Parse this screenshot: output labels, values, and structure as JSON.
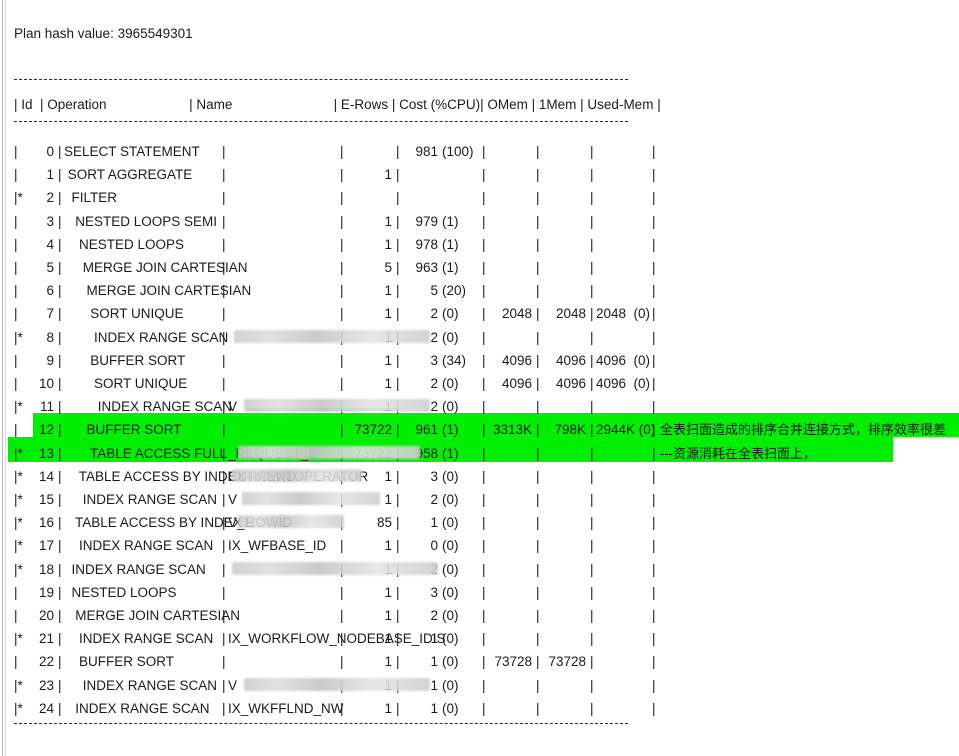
{
  "document": {
    "plan_hash_label": "Plan hash value: 3965549301",
    "separator": "----------------------------------------------------------------------------------------"
  },
  "table": {
    "header": "| Id  | Operation                      | Name                           | E-Rows | Cost (%CPU)| OMem | 1Mem | Used-Mem |",
    "columns": [
      "Id",
      "Operation",
      "Name",
      "E-Rows",
      "Cost (%CPU)",
      "OMem",
      "1Mem",
      "Used-Mem"
    ],
    "rows": [
      {
        "star": "",
        "id": "0",
        "operation": "SELECT STATEMENT",
        "name": "",
        "name_redacted": false,
        "erows": "",
        "cost": "981",
        "cpu": "(100)",
        "omem": "",
        "mem1": "",
        "used": "",
        "highlight": false,
        "note": ""
      },
      {
        "star": "",
        "id": "1",
        "operation": " SORT AGGREGATE",
        "name": "",
        "name_redacted": false,
        "erows": "1",
        "cost": "",
        "cpu": "",
        "omem": "",
        "mem1": "",
        "used": "",
        "highlight": false,
        "note": ""
      },
      {
        "star": "*",
        "id": "2",
        "operation": "  FILTER",
        "name": "",
        "name_redacted": false,
        "erows": "",
        "cost": "",
        "cpu": "",
        "omem": "",
        "mem1": "",
        "used": "",
        "highlight": false,
        "note": ""
      },
      {
        "star": "",
        "id": "3",
        "operation": "   NESTED LOOPS SEMI",
        "name": "",
        "name_redacted": false,
        "erows": "1",
        "cost": "979",
        "cpu": "(1)",
        "omem": "",
        "mem1": "",
        "used": "",
        "highlight": false,
        "note": ""
      },
      {
        "star": "",
        "id": "4",
        "operation": "    NESTED LOOPS",
        "name": "",
        "name_redacted": false,
        "erows": "1",
        "cost": "978",
        "cpu": "(1)",
        "omem": "",
        "mem1": "",
        "used": "",
        "highlight": false,
        "note": ""
      },
      {
        "star": "",
        "id": "5",
        "operation": "     MERGE JOIN CARTESIAN",
        "name": "",
        "name_redacted": false,
        "erows": "5",
        "cost": "963",
        "cpu": "(1)",
        "omem": "",
        "mem1": "",
        "used": "",
        "highlight": false,
        "note": ""
      },
      {
        "star": "",
        "id": "6",
        "operation": "      MERGE JOIN CARTESIAN",
        "name": "",
        "name_redacted": false,
        "erows": "1",
        "cost": "5",
        "cpu": "(20)",
        "omem": "",
        "mem1": "",
        "used": "",
        "highlight": false,
        "note": ""
      },
      {
        "star": "",
        "id": "7",
        "operation": "       SORT UNIQUE",
        "name": "",
        "name_redacted": false,
        "erows": "1",
        "cost": "2",
        "cpu": "(0)",
        "omem": "2048",
        "mem1": "2048",
        "used": "2048  (0)",
        "highlight": false,
        "note": ""
      },
      {
        "star": "*",
        "id": "8",
        "operation": "        INDEX RANGE SCAN",
        "name": "",
        "name_redacted": true,
        "erows": "1",
        "cost": "2",
        "cpu": "(0)",
        "omem": "",
        "mem1": "",
        "used": "",
        "highlight": false,
        "note": ""
      },
      {
        "star": "",
        "id": "9",
        "operation": "       BUFFER SORT",
        "name": "",
        "name_redacted": false,
        "erows": "1",
        "cost": "3",
        "cpu": "(34)",
        "omem": "4096",
        "mem1": "4096",
        "used": "4096  (0)",
        "highlight": false,
        "note": ""
      },
      {
        "star": "",
        "id": "10",
        "operation": "        SORT UNIQUE",
        "name": "",
        "name_redacted": false,
        "erows": "1",
        "cost": "2",
        "cpu": "(0)",
        "omem": "4096",
        "mem1": "4096",
        "used": "4096  (0)",
        "highlight": false,
        "note": ""
      },
      {
        "star": "*",
        "id": "11",
        "operation": "         INDEX RANGE SCAN",
        "name": "V",
        "name_redacted": true,
        "erows": "1",
        "cost": "2",
        "cpu": "(0)",
        "omem": "",
        "mem1": "",
        "used": "",
        "highlight": false,
        "note": ""
      },
      {
        "star": "",
        "id": "12",
        "operation": "      BUFFER SORT",
        "name": "",
        "name_redacted": false,
        "erows": "73722",
        "cost": "961",
        "cpu": "(1)",
        "omem": "3313K",
        "mem1": "798K",
        "used": "2944K (0)",
        "highlight": true,
        "note": "全表扫面造成的排序合并连接方式，排序效率很差"
      },
      {
        "star": "*",
        "id": "13",
        "operation": "       TABLE ACCESS FULL",
        "name": "_REQUEST_E",
        "name_redacted": true,
        "erows": "73722",
        "cost": "958",
        "cpu": "(1)",
        "omem": "",
        "mem1": "",
        "used": "",
        "highlight": true,
        "note": "---资源消耗在全表扫面上，"
      },
      {
        "star": "*",
        "id": "14",
        "operation": "    TABLE ACCESS BY INDEX ROWID",
        "name": "CURRENTOPERATOR",
        "name_redacted": true,
        "erows": "1",
        "cost": "3",
        "cpu": "(0)",
        "omem": "",
        "mem1": "",
        "used": "",
        "highlight": false,
        "note": ""
      },
      {
        "star": "*",
        "id": "15",
        "operation": "     INDEX RANGE SCAN",
        "name": "V",
        "name_redacted": true,
        "erows": "1",
        "cost": "2",
        "cpu": "(0)",
        "omem": "",
        "mem1": "",
        "used": "",
        "highlight": false,
        "note": ""
      },
      {
        "star": "*",
        "id": "16",
        "operation": "   TABLE ACCESS BY INDEX ROWID",
        "name": "V_E",
        "name_redacted": true,
        "erows": "85",
        "cost": "1",
        "cpu": "(0)",
        "omem": "",
        "mem1": "",
        "used": "",
        "highlight": false,
        "note": ""
      },
      {
        "star": "*",
        "id": "17",
        "operation": "    INDEX RANGE SCAN",
        "name": "IX_WFBASE_ID",
        "name_redacted": false,
        "erows": "1",
        "cost": "0",
        "cpu": "(0)",
        "omem": "",
        "mem1": "",
        "used": "",
        "highlight": false,
        "note": ""
      },
      {
        "star": "*",
        "id": "18",
        "operation": "  INDEX RANGE SCAN",
        "name": "",
        "name_redacted": true,
        "erows": "1",
        "cost": "2",
        "cpu": "(0)",
        "omem": "",
        "mem1": "",
        "used": "",
        "highlight": false,
        "note": ""
      },
      {
        "star": "",
        "id": "19",
        "operation": "  NESTED LOOPS",
        "name": "",
        "name_redacted": false,
        "erows": "1",
        "cost": "3",
        "cpu": "(0)",
        "omem": "",
        "mem1": "",
        "used": "",
        "highlight": false,
        "note": ""
      },
      {
        "star": "",
        "id": "20",
        "operation": "   MERGE JOIN CARTESIAN",
        "name": "",
        "name_redacted": false,
        "erows": "1",
        "cost": "2",
        "cpu": "(0)",
        "omem": "",
        "mem1": "",
        "used": "",
        "highlight": false,
        "note": ""
      },
      {
        "star": "*",
        "id": "21",
        "operation": "    INDEX RANGE SCAN",
        "name": "IX_WORKFLOW_NODEBASE_IDIS",
        "name_redacted": false,
        "erows": "1",
        "cost": "1",
        "cpu": "(0)",
        "omem": "",
        "mem1": "",
        "used": "",
        "highlight": false,
        "note": ""
      },
      {
        "star": "",
        "id": "22",
        "operation": "    BUFFER SORT",
        "name": "",
        "name_redacted": false,
        "erows": "1",
        "cost": "1",
        "cpu": "(0)",
        "omem": "73728",
        "mem1": "73728",
        "used": "",
        "highlight": false,
        "note": ""
      },
      {
        "star": "*",
        "id": "23",
        "operation": "     INDEX RANGE SCAN",
        "name": "V",
        "name_redacted": true,
        "erows": "1",
        "cost": "1",
        "cpu": "(0)",
        "omem": "",
        "mem1": "",
        "used": "",
        "highlight": false,
        "note": ""
      },
      {
        "star": "*",
        "id": "24",
        "operation": "   INDEX RANGE SCAN",
        "name": "IX_WKFFLND_NW",
        "name_redacted": false,
        "erows": "1",
        "cost": "1",
        "cpu": "(0)",
        "omem": "",
        "mem1": "",
        "used": "",
        "highlight": false,
        "note": ""
      }
    ]
  },
  "colors": {
    "highlight": "#00ef00",
    "text": "#1b1b1b",
    "redaction": "#cfcfcf"
  }
}
